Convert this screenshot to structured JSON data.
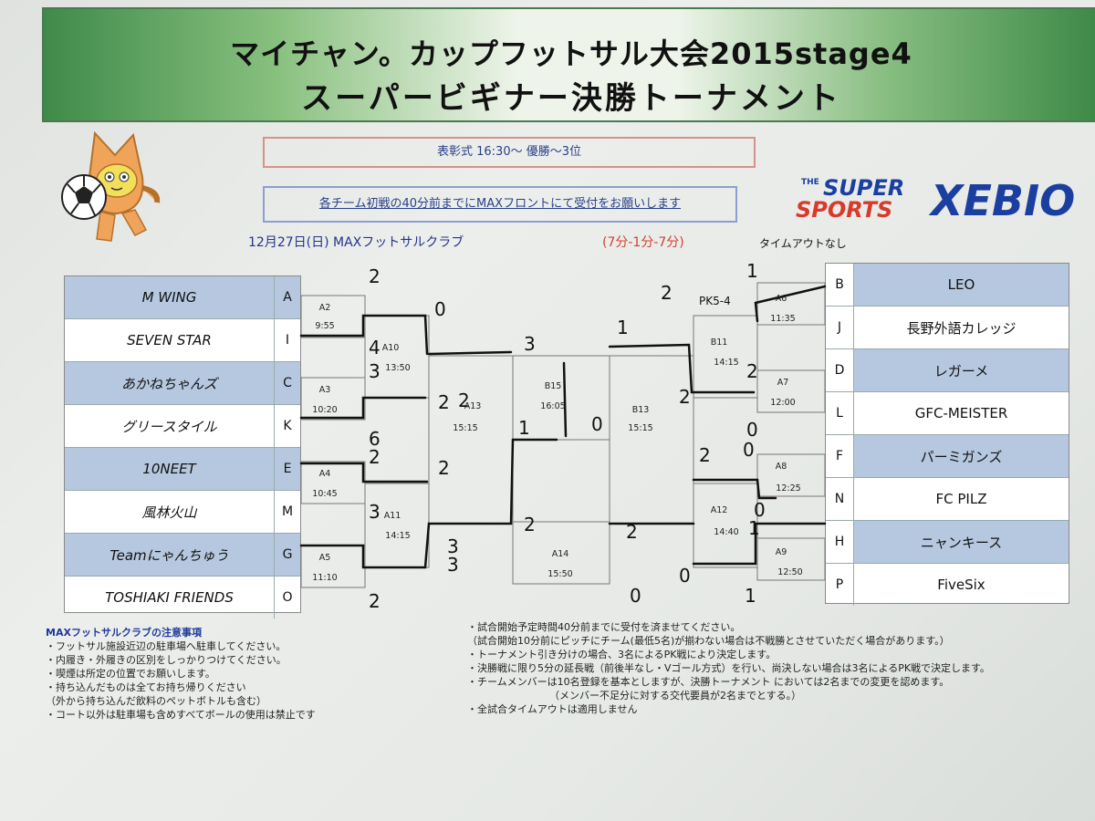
{
  "header": {
    "title_line1": "マイチャン。カップフットサル大会2015stage4",
    "title_line2": "スーパービギナー決勝トーナメント"
  },
  "info": {
    "award": "表彰式 16:30～ 優勝～3位",
    "reception": "各チーム初戦の40分前までにMAXフロントにて受付をお願いします"
  },
  "logo": {
    "line1": "THE SUPER SPORTS",
    "line2": "XEBIO"
  },
  "event": {
    "date": "12月27日(日) MAXフットサルクラブ",
    "format": "(7分-1分-7分)",
    "timeout": "タイムアウトなし"
  },
  "left_teams": [
    {
      "name": "M WING",
      "code": "A"
    },
    {
      "name": "SEVEN STAR",
      "code": "I"
    },
    {
      "name": "あかねちゃんズ",
      "code": "C"
    },
    {
      "name": "グリースタイル",
      "code": "K"
    },
    {
      "name": "10NEET",
      "code": "E"
    },
    {
      "name": "風林火山",
      "code": "M"
    },
    {
      "name": "Teamにゃんちゅう",
      "code": "G"
    },
    {
      "name": "TOSHIAKI FRIENDS",
      "code": "O"
    }
  ],
  "right_teams": [
    {
      "name": "LEO",
      "code": "B"
    },
    {
      "name": "長野外語カレッジ",
      "code": "J"
    },
    {
      "name": "レガーメ",
      "code": "D"
    },
    {
      "name": "GFC-MEISTER",
      "code": "L"
    },
    {
      "name": "パーミガンズ",
      "code": "F"
    },
    {
      "name": "FC PILZ",
      "code": "N"
    },
    {
      "name": "ニャンキース",
      "code": "H"
    },
    {
      "name": "FiveSix",
      "code": "P"
    }
  ],
  "matches": [
    {
      "id": "A2",
      "time": "9:55"
    },
    {
      "id": "A3",
      "time": "10:20"
    },
    {
      "id": "A4",
      "time": "10:45"
    },
    {
      "id": "A5",
      "time": "11:10"
    },
    {
      "id": "A10",
      "time": "13:50"
    },
    {
      "id": "A11",
      "time": "14:15"
    },
    {
      "id": "A13",
      "time": "15:15"
    },
    {
      "id": "B15",
      "time": "16:05"
    },
    {
      "id": "A14",
      "time": "15:50"
    },
    {
      "id": "B13",
      "time": "15:15"
    },
    {
      "id": "B11",
      "time": "14:15"
    },
    {
      "id": "A12",
      "time": "14:40"
    },
    {
      "id": "A6",
      "time": "11:35"
    },
    {
      "id": "A7",
      "time": "12:00"
    },
    {
      "id": "A8",
      "time": "12:25"
    },
    {
      "id": "A9",
      "time": "12:50"
    }
  ],
  "notes_left": {
    "heading": "MAXフットサルクラブの注意事項",
    "items": [
      "・フットサル施設近辺の駐車場へ駐車してください。",
      "・内履き・外履きの区別をしっかりつけてください。",
      "・喫煙は所定の位置でお願いします。",
      "・持ち込んだものは全てお持ち帰りください",
      "（外から持ち込んだ飲料のペットボトルも含む）",
      "・コート以外は駐車場も含めすべてボールの使用は禁止です"
    ]
  },
  "notes_right": [
    "・試合開始予定時間40分前までに受付を済ませてください。",
    "（試合開始10分前にピッチにチーム(最低5名)が揃わない場合は不戦勝とさせていただく場合があります。）",
    "・トーナメント引き分けの場合、3名によるPK戦により決定します。",
    "・決勝戦に限り5分の延長戦（前後半なし・Vゴール方式）を行い、尚決しない場合は3名によるPK戦で決定します。",
    "・チームメンバーは10名登録を基本としますが、決勝トーナメント においては2名までの変更を認めます。",
    "（メンバー不足分に対する交代要員が2名までとする。）",
    "・全試合タイムアウトは適用しません"
  ],
  "handwritten_scores": [
    "2",
    "0",
    "4",
    "3",
    "2",
    "3",
    "6",
    "2",
    "2",
    "3",
    "3",
    "2",
    "2",
    "1",
    "0",
    "1",
    "2",
    "2",
    "1",
    "2",
    "2",
    "2",
    "0",
    "0",
    "0",
    "1",
    "0",
    "3",
    "2",
    "0",
    "1"
  ],
  "handwritten_notes": [
    "PK5-4"
  ]
}
